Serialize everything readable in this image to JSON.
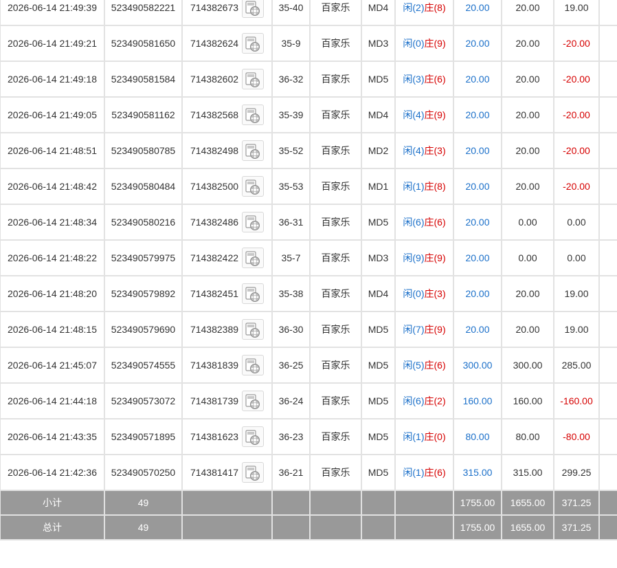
{
  "rows": [
    {
      "time": "2026-06-14 21:49:39",
      "order": "523490582221",
      "game": "714382673",
      "table": "35-40",
      "name": "百家乐",
      "device": "MD4",
      "player": "闲(2)",
      "banker": "庄(8)",
      "bet": "20.00",
      "valid": "20.00",
      "win": "19.00",
      "win_color": "black"
    },
    {
      "time": "2026-06-14 21:49:21",
      "order": "523490581650",
      "game": "714382624",
      "table": "35-9",
      "name": "百家乐",
      "device": "MD3",
      "player": "闲(0)",
      "banker": "庄(9)",
      "bet": "20.00",
      "valid": "20.00",
      "win": "-20.00",
      "win_color": "red"
    },
    {
      "time": "2026-06-14 21:49:18",
      "order": "523490581584",
      "game": "714382602",
      "table": "36-32",
      "name": "百家乐",
      "device": "MD5",
      "player": "闲(3)",
      "banker": "庄(6)",
      "bet": "20.00",
      "valid": "20.00",
      "win": "-20.00",
      "win_color": "red"
    },
    {
      "time": "2026-06-14 21:49:05",
      "order": "523490581162",
      "game": "714382568",
      "table": "35-39",
      "name": "百家乐",
      "device": "MD4",
      "player": "闲(4)",
      "banker": "庄(9)",
      "bet": "20.00",
      "valid": "20.00",
      "win": "-20.00",
      "win_color": "red"
    },
    {
      "time": "2026-06-14 21:48:51",
      "order": "523490580785",
      "game": "714382498",
      "table": "35-52",
      "name": "百家乐",
      "device": "MD2",
      "player": "闲(4)",
      "banker": "庄(3)",
      "bet": "20.00",
      "valid": "20.00",
      "win": "-20.00",
      "win_color": "red"
    },
    {
      "time": "2026-06-14 21:48:42",
      "order": "523490580484",
      "game": "714382500",
      "table": "35-53",
      "name": "百家乐",
      "device": "MD1",
      "player": "闲(1)",
      "banker": "庄(8)",
      "bet": "20.00",
      "valid": "20.00",
      "win": "-20.00",
      "win_color": "red"
    },
    {
      "time": "2026-06-14 21:48:34",
      "order": "523490580216",
      "game": "714382486",
      "table": "36-31",
      "name": "百家乐",
      "device": "MD5",
      "player": "闲(6)",
      "banker": "庄(6)",
      "bet": "20.00",
      "valid": "0.00",
      "win": "0.00",
      "win_color": "black"
    },
    {
      "time": "2026-06-14 21:48:22",
      "order": "523490579975",
      "game": "714382422",
      "table": "35-7",
      "name": "百家乐",
      "device": "MD3",
      "player": "闲(9)",
      "banker": "庄(9)",
      "bet": "20.00",
      "valid": "0.00",
      "win": "0.00",
      "win_color": "black"
    },
    {
      "time": "2026-06-14 21:48:20",
      "order": "523490579892",
      "game": "714382451",
      "table": "35-38",
      "name": "百家乐",
      "device": "MD4",
      "player": "闲(0)",
      "banker": "庄(3)",
      "bet": "20.00",
      "valid": "20.00",
      "win": "19.00",
      "win_color": "black"
    },
    {
      "time": "2026-06-14 21:48:15",
      "order": "523490579690",
      "game": "714382389",
      "table": "36-30",
      "name": "百家乐",
      "device": "MD5",
      "player": "闲(7)",
      "banker": "庄(9)",
      "bet": "20.00",
      "valid": "20.00",
      "win": "19.00",
      "win_color": "black"
    },
    {
      "time": "2026-06-14 21:45:07",
      "order": "523490574555",
      "game": "714381839",
      "table": "36-25",
      "name": "百家乐",
      "device": "MD5",
      "player": "闲(5)",
      "banker": "庄(6)",
      "bet": "300.00",
      "valid": "300.00",
      "win": "285.00",
      "win_color": "black"
    },
    {
      "time": "2026-06-14 21:44:18",
      "order": "523490573072",
      "game": "714381739",
      "table": "36-24",
      "name": "百家乐",
      "device": "MD5",
      "player": "闲(6)",
      "banker": "庄(2)",
      "bet": "160.00",
      "valid": "160.00",
      "win": "-160.00",
      "win_color": "red"
    },
    {
      "time": "2026-06-14 21:43:35",
      "order": "523490571895",
      "game": "714381623",
      "table": "36-23",
      "name": "百家乐",
      "device": "MD5",
      "player": "闲(1)",
      "banker": "庄(0)",
      "bet": "80.00",
      "valid": "80.00",
      "win": "-80.00",
      "win_color": "red"
    },
    {
      "time": "2026-06-14 21:42:36",
      "order": "523490570250",
      "game": "714381417",
      "table": "36-21",
      "name": "百家乐",
      "device": "MD5",
      "player": "闲(1)",
      "banker": "庄(6)",
      "bet": "315.00",
      "valid": "315.00",
      "win": "299.25",
      "win_color": "black"
    }
  ],
  "subtotal": {
    "label": "小计",
    "count": "49",
    "bet": "1755.00",
    "valid": "1655.00",
    "win": "371.25"
  },
  "total": {
    "label": "总计",
    "count": "49",
    "bet": "1755.00",
    "valid": "1655.00",
    "win": "371.25"
  },
  "icons": {
    "replay": "video-replay-icon"
  },
  "colors": {
    "blue": "#1a6fc9",
    "red": "#d60000",
    "summary_bg": "#999999"
  }
}
